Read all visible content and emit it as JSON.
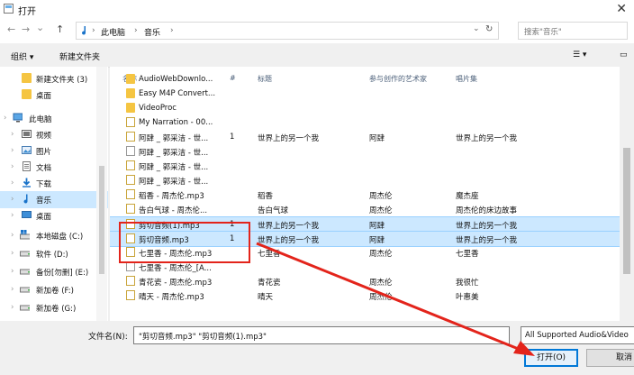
{
  "window": {
    "title": "打开",
    "close_glyph": "✕"
  },
  "nav": {
    "back": "←",
    "forward": "→",
    "dropdown": "⌄",
    "up": "↑",
    "path": [
      "此电脑",
      "音乐"
    ],
    "refresh": "↻",
    "search_placeholder": "搜索\"音乐\""
  },
  "toolbar": {
    "organize": "组织 ▾",
    "new_folder": "新建文件夹"
  },
  "sidebar": {
    "items": [
      {
        "label": "新建文件夹 (3)"
      },
      {
        "label": "桌面"
      },
      {
        "label": "此电脑"
      },
      {
        "label": "视频"
      },
      {
        "label": "图片"
      },
      {
        "label": "文档"
      },
      {
        "label": "下载"
      },
      {
        "label": "音乐"
      },
      {
        "label": "桌面"
      },
      {
        "label": "本地磁盘 (C:)"
      },
      {
        "label": "软件 (D:)"
      },
      {
        "label": "备份[勿删] (E:)"
      },
      {
        "label": "新加卷 (F:)"
      },
      {
        "label": "新加卷 (G:)"
      }
    ]
  },
  "columns": {
    "name": "名称",
    "number": "#",
    "title": "标题",
    "artist": "参与创作的艺术家",
    "album": "唱片集"
  },
  "files": [
    {
      "name": "AudioWebDownlo...",
      "number": "",
      "title": "",
      "artist": "",
      "album": "",
      "type": "folder"
    },
    {
      "name": "Easy M4P Convert...",
      "number": "",
      "title": "",
      "artist": "",
      "album": "",
      "type": "folder"
    },
    {
      "name": "VideoProc",
      "number": "",
      "title": "",
      "artist": "",
      "album": "",
      "type": "folder"
    },
    {
      "name": "My Narration - 00...",
      "number": "",
      "title": "",
      "artist": "",
      "album": "",
      "type": "mp3"
    },
    {
      "name": "阿肆 _ 郭采洁 - 世...",
      "number": "1",
      "title": "世界上的另一个我",
      "artist": "阿肆",
      "album": "世界上的另一个我",
      "type": "mp3"
    },
    {
      "name": "阿肆 _ 郭采洁 - 世...",
      "number": "",
      "title": "",
      "artist": "",
      "album": "",
      "type": "doc"
    },
    {
      "name": "阿肆 _ 郭采洁 - 世...",
      "number": "",
      "title": "",
      "artist": "",
      "album": "",
      "type": "mp3"
    },
    {
      "name": "阿肆 _ 郭采洁 - 世...",
      "number": "",
      "title": "",
      "artist": "",
      "album": "",
      "type": "mp3"
    },
    {
      "name": "稻香 - 周杰伦.mp3",
      "number": "",
      "title": "稻香",
      "artist": "周杰伦",
      "album": "魔杰座",
      "type": "mp3"
    },
    {
      "name": "告白气球 - 周杰伦...",
      "number": "",
      "title": "告白气球",
      "artist": "周杰伦",
      "album": "周杰伦的床边故事",
      "type": "mp3"
    },
    {
      "name": "剪切音频(1).mp3",
      "number": "1",
      "title": "世界上的另一个我",
      "artist": "阿肆",
      "album": "世界上的另一个我",
      "type": "mp3",
      "selected": true
    },
    {
      "name": "剪切音频.mp3",
      "number": "1",
      "title": "世界上的另一个我",
      "artist": "阿肆",
      "album": "世界上的另一个我",
      "type": "mp3",
      "selected": true
    },
    {
      "name": "七里香 - 周杰伦.mp3",
      "number": "",
      "title": "七里香",
      "artist": "周杰伦",
      "album": "七里香",
      "type": "mp3"
    },
    {
      "name": "七里香 - 周杰伦_[A...",
      "number": "",
      "title": "",
      "artist": "",
      "album": "",
      "type": "doc"
    },
    {
      "name": "青花瓷 - 周杰伦.mp3",
      "number": "",
      "title": "青花瓷",
      "artist": "周杰伦",
      "album": "我很忙",
      "type": "mp3"
    },
    {
      "name": "晴天 - 周杰伦.mp3",
      "number": "",
      "title": "晴天",
      "artist": "周杰伦",
      "album": "叶惠美",
      "type": "mp3"
    }
  ],
  "bottom": {
    "filename_label": "文件名(N):",
    "filename_value": "\"剪切音频.mp3\" \"剪切音频(1).mp3\"",
    "filter_value": "All Supported Audio&Video",
    "open_label": "打开(O)",
    "cancel_label": "取消"
  },
  "colors": {
    "selection": "#cce8ff",
    "annotation": "#e3241b",
    "accent": "#0078d7"
  }
}
